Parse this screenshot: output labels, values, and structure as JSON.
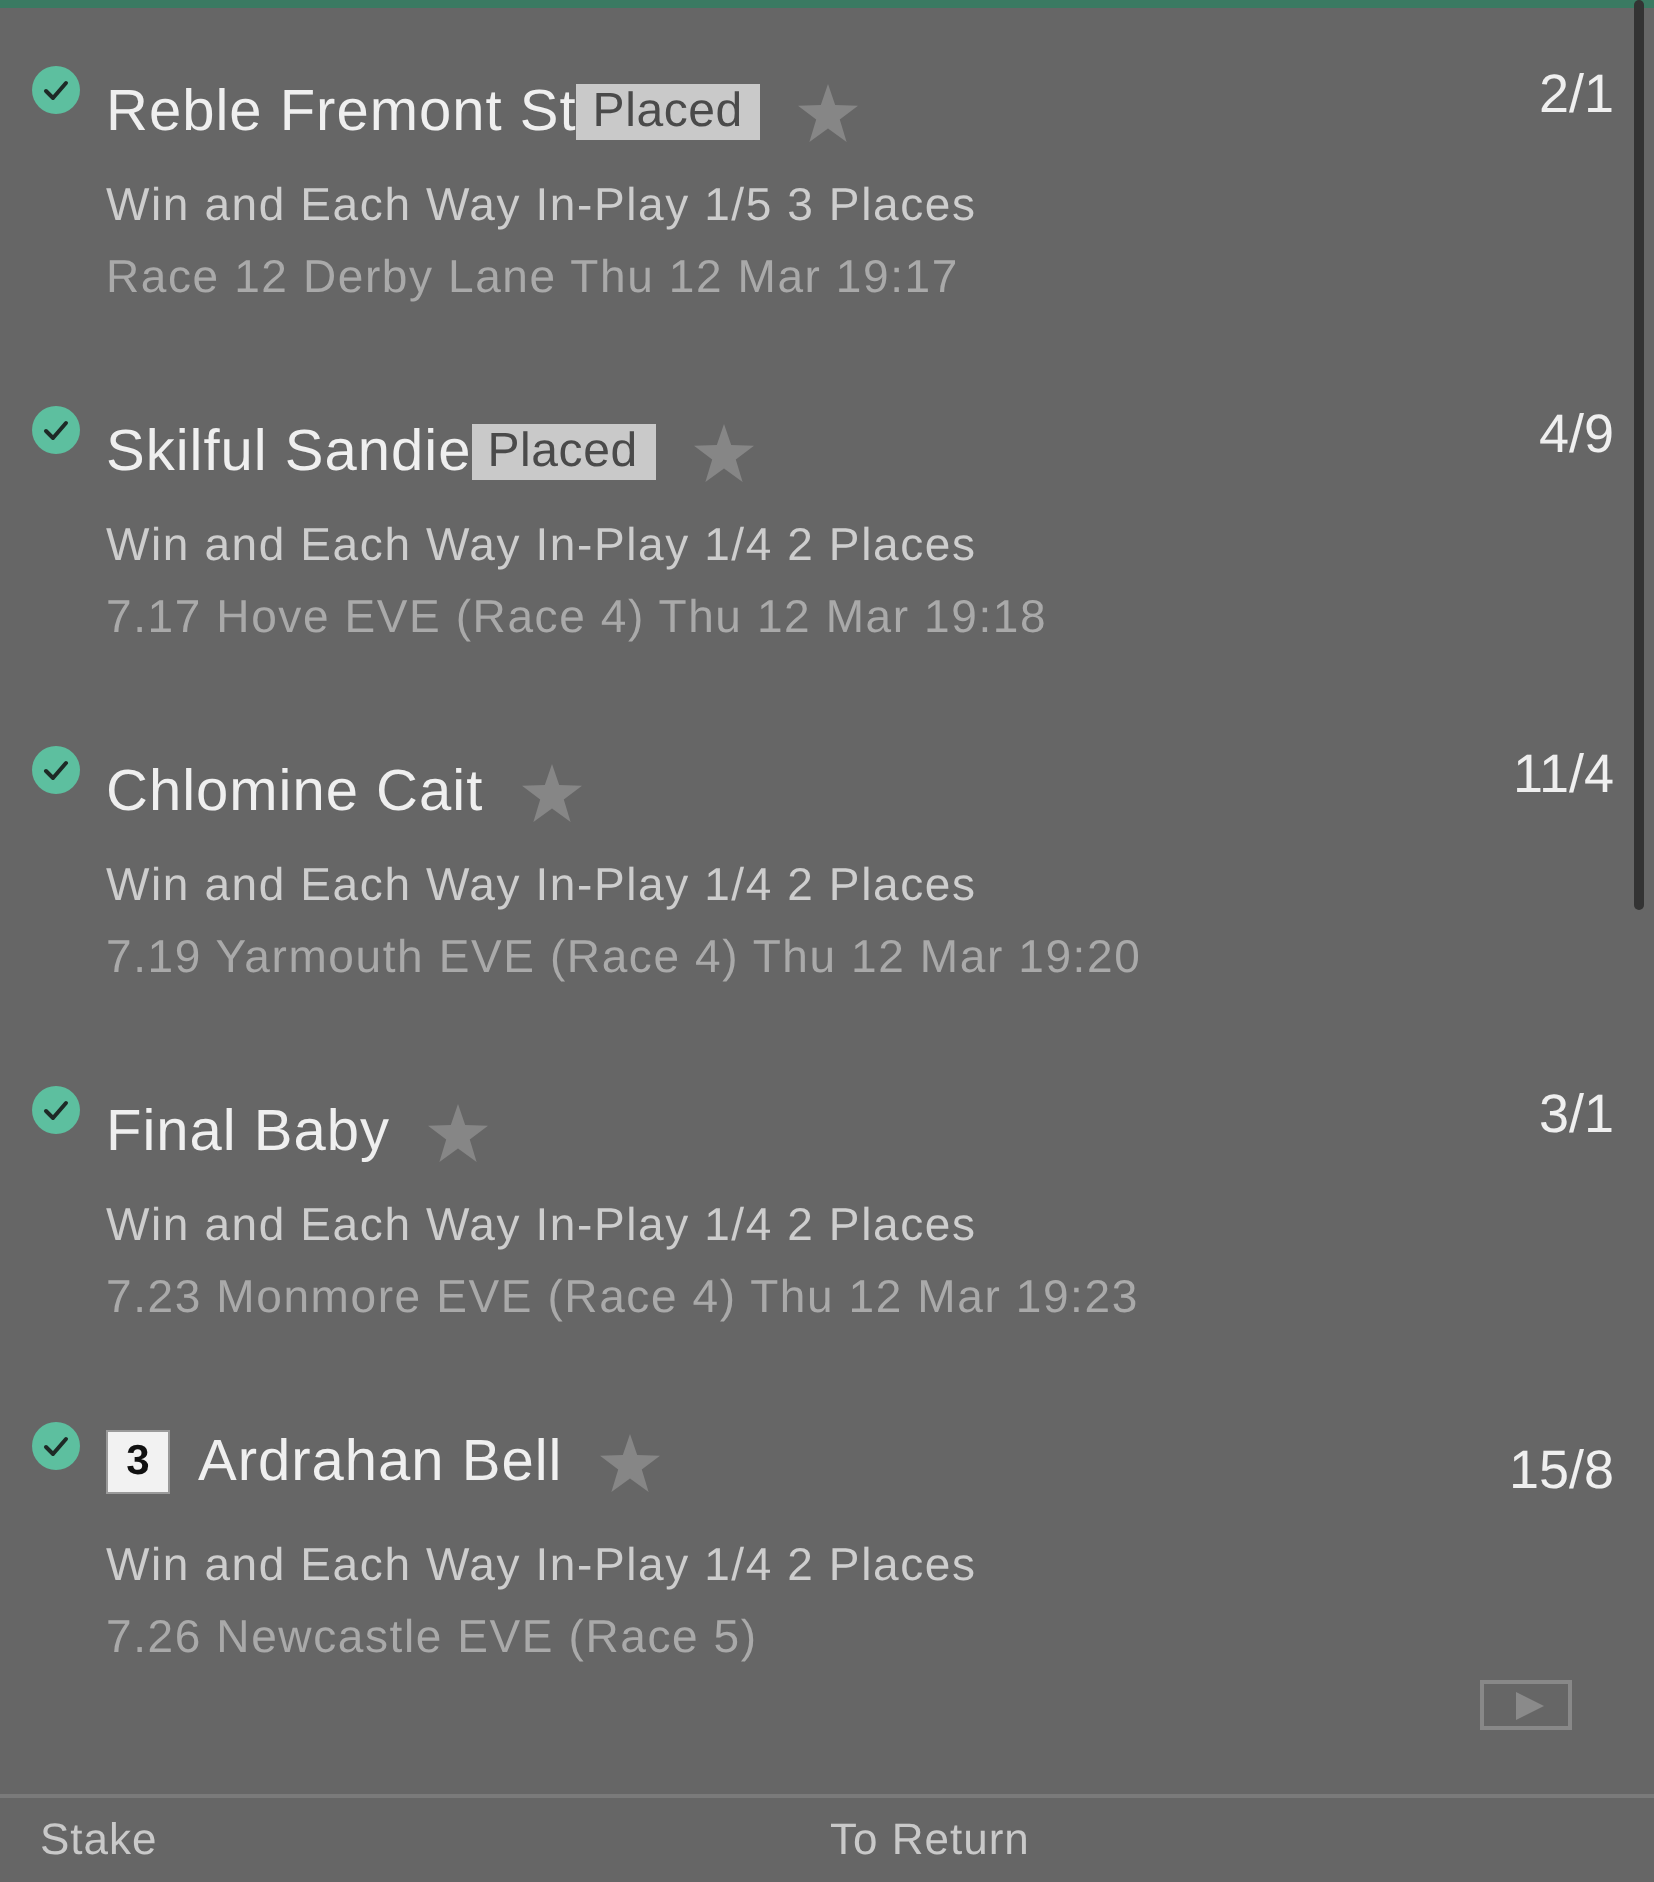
{
  "bets": [
    {
      "checked": true,
      "selection": "Reble Fremont St",
      "status": "Placed",
      "starred": false,
      "odds": "2/1",
      "market": "Win and Each Way In-Play 1/5 3 Places",
      "event": "Race 12 Derby Lane Thu 12 Mar 19:17"
    },
    {
      "checked": true,
      "selection": "Skilful Sandie",
      "status": "Placed",
      "starred": false,
      "odds": "4/9",
      "market": "Win and Each Way In-Play 1/4 2 Places",
      "event": "7.17 Hove EVE (Race 4) Thu 12 Mar 19:18"
    },
    {
      "checked": true,
      "selection": "Chlomine Cait",
      "starred": false,
      "odds": "11/4",
      "market": "Win and Each Way In-Play 1/4 2 Places",
      "event": "7.19 Yarmouth EVE (Race 4) Thu 12 Mar 19:20"
    },
    {
      "checked": true,
      "selection": "Final Baby",
      "starred": false,
      "odds": "3/1",
      "market": "Win and Each Way In-Play 1/4 2 Places",
      "event": "7.23 Monmore EVE (Race 4) Thu 12 Mar 19:23"
    },
    {
      "checked": true,
      "trap": "3",
      "selection": "Ardrahan Bell",
      "starred": false,
      "odds": "15/8",
      "market": "Win and Each Way In-Play 1/4 2 Places",
      "event": "7.26 Newcastle EVE (Race 5)",
      "video": true
    }
  ],
  "footer": {
    "stake_label": "Stake",
    "return_label": "To Return"
  }
}
